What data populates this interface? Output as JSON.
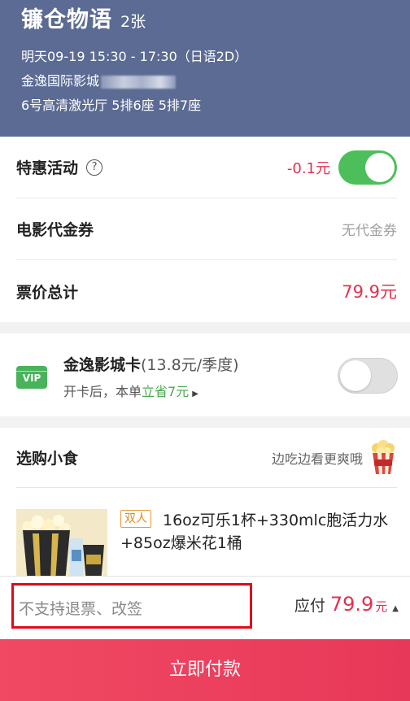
{
  "header": {
    "movie_title": "镰仓物语",
    "ticket_count": "2张",
    "showtime": "明天09-19 15:30 - 17:30（日语2D）",
    "cinema": "金逸国际影城",
    "seats": "6号高清激光厅 5排6座 5排7座"
  },
  "discount_row": {
    "label": "特惠活动",
    "help_icon": "question-circle-icon",
    "value": "-0.1元",
    "toggle_on": true
  },
  "voucher_row": {
    "label": "电影代金券",
    "value": "无代金券"
  },
  "total_row": {
    "label": "票价总计",
    "value": "79.9元"
  },
  "vip_card": {
    "badge": "VIP",
    "name": "金逸影城卡",
    "price": "(13.8元/季度)",
    "sub_prefix": "开卡后，本单",
    "sub_save": "立省7元",
    "toggle_on": false
  },
  "snacks": {
    "label": "选购小食",
    "tip": "边吃边看更爽哦",
    "item": {
      "tag": "双人",
      "name": "16oz可乐1杯+330mlc胞活力水+85oz爆米花1桶"
    }
  },
  "bottom": {
    "notice": "不支持退票、改签",
    "pay_label": "应付",
    "pay_amount": "79.9",
    "pay_unit": "元"
  },
  "pay_button": {
    "label": "立即付款"
  },
  "colors": {
    "header_bg": "#5b6b94",
    "accent_red": "#e2314f",
    "toggle_green": "#4cbf5a",
    "vip_green": "#48b35a",
    "button_pink": "#ee4360",
    "highlight_border": "#e00a1a"
  }
}
